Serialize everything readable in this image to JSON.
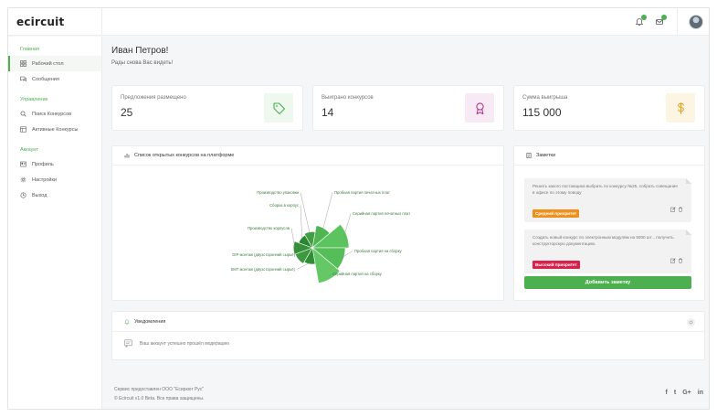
{
  "app": {
    "logo": "ecircuit"
  },
  "colors": {
    "accent": "#4caf50",
    "sidebar_section": "#4caf50"
  },
  "topbar": {
    "icons": [
      "bell-icon",
      "chat-icon"
    ]
  },
  "sidebar": {
    "sections": [
      {
        "title": "Главная",
        "items": [
          {
            "label": "Рабочий стол",
            "icon": "dashboard-icon",
            "active": true
          },
          {
            "label": "Сообщения",
            "icon": "messages-icon"
          }
        ]
      },
      {
        "title": "Управление",
        "items": [
          {
            "label": "Поиск Конкурсов",
            "icon": "search-icon"
          },
          {
            "label": "Активные Конкурсы",
            "icon": "active-contests-icon"
          }
        ]
      },
      {
        "title": "Аккаунт",
        "items": [
          {
            "label": "Профиль",
            "icon": "profile-icon"
          },
          {
            "label": "Настройки",
            "icon": "gear-icon"
          },
          {
            "label": "Выход",
            "icon": "power-icon"
          }
        ]
      }
    ]
  },
  "main": {
    "greeting": "Иван Петров!",
    "subtitle": "Рады снова Вас видеть!"
  },
  "stats": [
    {
      "label": "Предложения размещено",
      "value": "25",
      "icon": "tag-icon",
      "icon_color": "#4caf50",
      "icon_bg": "#eef8ee"
    },
    {
      "label": "Выиграно конкурсов",
      "value": "14",
      "icon": "award-icon",
      "icon_color": "#b3388f",
      "icon_bg": "#f8eaf4"
    },
    {
      "label": "Сумма выигрыша",
      "value": "115 000",
      "icon": "dollar-icon",
      "icon_color": "#e8a21c",
      "icon_bg": "#fdf5e4"
    }
  ],
  "contests_card": {
    "title": "Список открытых конкурсов на платформе"
  },
  "chart_data": {
    "type": "pie",
    "variant": "polar-area",
    "categories": [
      "Пробная партия печатных плат",
      "Серийная партия печатных плат",
      "Пробная партия на сборку",
      "Серийная партия на сборку",
      "SMT монтаж (двухсторонний сырьё)",
      "DIP монтаж (двухсторонний сырьё)",
      "Производство корпусов",
      "Сборка в корпус",
      "Производство упаковки"
    ],
    "values": [
      0.62,
      1.0,
      0.9,
      0.98,
      0.45,
      0.5,
      0.52,
      0.4,
      0.44
    ]
  },
  "notes_card": {
    "title": "Заметки",
    "notes": [
      {
        "text": "Решить какого поставщика выбрать по конкурсу №25, собрать совещание в офисе по этому поводу",
        "badge": "Средний приоритет",
        "badge_color": "#f0901c"
      },
      {
        "text": "Создать новый конкурс по электронным модулям на 5000 шт... получить конструкторскую документацию.",
        "badge": "Высокий приоритет",
        "badge_color": "#d9224b"
      }
    ],
    "add_label": "Добавить заметку"
  },
  "notifications": {
    "title": "Уведомления",
    "items": [
      {
        "text": "Ваш аккаунт успешно прошёл модерацию"
      }
    ]
  },
  "footer": {
    "line1": "Сервис предоставлен ООО \"Есиркют Рус\"",
    "line2": "© Ecircuit v1.0 Beta. Все права защищены.",
    "social": [
      "f",
      "t",
      "G+",
      "in"
    ]
  }
}
